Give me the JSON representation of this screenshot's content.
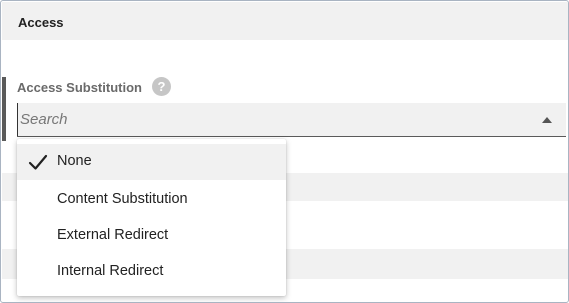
{
  "section": {
    "title": "Access"
  },
  "field": {
    "label": "Access Substitution",
    "help_glyph": "?",
    "search_placeholder": "Search"
  },
  "dropdown": {
    "options": [
      {
        "label": "None",
        "selected": true
      },
      {
        "label": "Content Substitution",
        "selected": false
      },
      {
        "label": "External Redirect",
        "selected": false
      },
      {
        "label": "Internal Redirect",
        "selected": false
      }
    ]
  },
  "icons": {
    "help": "question-circle-icon",
    "caret": "caret-up-icon",
    "check": "checkmark-icon"
  }
}
